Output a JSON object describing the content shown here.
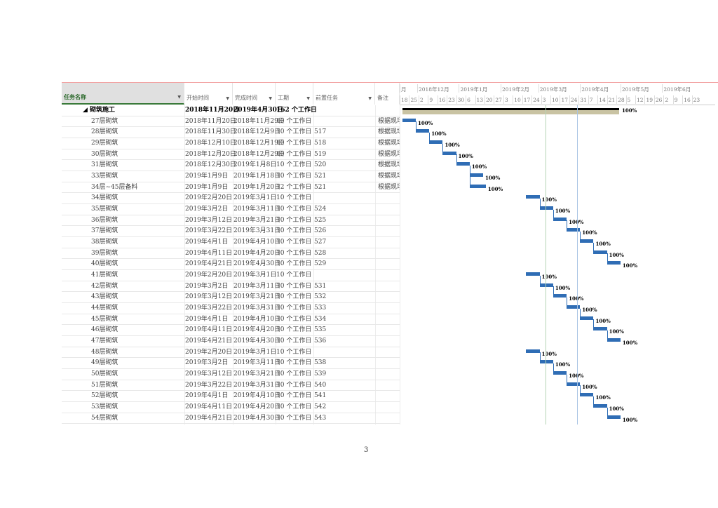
{
  "columns": {
    "name": "任务名称",
    "start": "开始时间",
    "finish": "完成时间",
    "duration": "工期",
    "predecessors": "前置任务",
    "notes": "备注"
  },
  "timescale": {
    "months": [
      "月",
      "2018年12月",
      "2019年1月",
      "2019年2月",
      "2019年3月",
      "2019年4月",
      "2019年5月",
      "2019年6月"
    ],
    "weeks": [
      "18",
      "25",
      "2",
      "9",
      "16",
      "23",
      "30",
      "6",
      "13",
      "20",
      "27",
      "3",
      "10",
      "17",
      "24",
      "3",
      "10",
      "17",
      "24",
      "31",
      "7",
      "14",
      "21",
      "28",
      "5",
      "12",
      "19",
      "26",
      "2",
      "9",
      "16",
      "23"
    ]
  },
  "summary": {
    "name": "砌筑施工",
    "start": "2018年11月20日",
    "finish": "2019年4月30日",
    "duration": "162 个工作日",
    "start_iso": "2018-11-20",
    "finish_iso": "2019-04-30",
    "progress": "100%"
  },
  "tasks": [
    {
      "name": "27层砌筑",
      "start": "2018年11月20日",
      "finish": "2018年11月29日",
      "duration": "10 个工作日",
      "pred": "",
      "note": "根据现场",
      "s": "2018-11-20",
      "f": "2018-11-29",
      "progress": "100%"
    },
    {
      "name": "28层砌筑",
      "start": "2018年11月30日",
      "finish": "2018年12月9日",
      "duration": "10 个工作日",
      "pred": "517",
      "note": "根据现场",
      "s": "2018-11-30",
      "f": "2018-12-09",
      "progress": "100%"
    },
    {
      "name": "29层砌筑",
      "start": "2018年12月10日",
      "finish": "2018年12月19日",
      "duration": "10 个工作日",
      "pred": "518",
      "note": "根据现场",
      "s": "2018-12-10",
      "f": "2018-12-19",
      "progress": "100%"
    },
    {
      "name": "30层砌筑",
      "start": "2018年12月20日",
      "finish": "2018年12月29日",
      "duration": "10 个工作日",
      "pred": "519",
      "note": "根据现场",
      "s": "2018-12-20",
      "f": "2018-12-29",
      "progress": "100%"
    },
    {
      "name": "31层砌筑",
      "start": "2018年12月30日",
      "finish": "2019年1月8日",
      "duration": "10 个工作日",
      "pred": "520",
      "note": "根据现场",
      "s": "2018-12-30",
      "f": "2019-01-08",
      "progress": "100%"
    },
    {
      "name": "33层砌筑",
      "start": "2019年1月9日",
      "finish": "2019年1月18日",
      "duration": "10 个工作日",
      "pred": "521",
      "note": "根据现场",
      "s": "2019-01-09",
      "f": "2019-01-18",
      "progress": "100%"
    },
    {
      "name": "34层~45层备料",
      "start": "2019年1月9日",
      "finish": "2019年1月20日",
      "duration": "12 个工作日",
      "pred": "521",
      "note": "根据现场",
      "s": "2019-01-09",
      "f": "2019-01-20",
      "progress": "100%"
    },
    {
      "name": "34层砌筑",
      "start": "2019年2月20日",
      "finish": "2019年3月1日",
      "duration": "10 个工作日",
      "pred": "",
      "note": "",
      "s": "2019-02-20",
      "f": "2019-03-01",
      "progress": "100%"
    },
    {
      "name": "35层砌筑",
      "start": "2019年3月2日",
      "finish": "2019年3月11日",
      "duration": "10 个工作日",
      "pred": "524",
      "note": "",
      "s": "2019-03-02",
      "f": "2019-03-11",
      "progress": "100%"
    },
    {
      "name": "36层砌筑",
      "start": "2019年3月12日",
      "finish": "2019年3月21日",
      "duration": "10 个工作日",
      "pred": "525",
      "note": "",
      "s": "2019-03-12",
      "f": "2019-03-21",
      "progress": "100%"
    },
    {
      "name": "37层砌筑",
      "start": "2019年3月22日",
      "finish": "2019年3月31日",
      "duration": "10 个工作日",
      "pred": "526",
      "note": "",
      "s": "2019-03-22",
      "f": "2019-03-31",
      "progress": "100%"
    },
    {
      "name": "38层砌筑",
      "start": "2019年4月1日",
      "finish": "2019年4月10日",
      "duration": "10 个工作日",
      "pred": "527",
      "note": "",
      "s": "2019-04-01",
      "f": "2019-04-10",
      "progress": "100%"
    },
    {
      "name": "39层砌筑",
      "start": "2019年4月11日",
      "finish": "2019年4月20日",
      "duration": "10 个工作日",
      "pred": "528",
      "note": "",
      "s": "2019-04-11",
      "f": "2019-04-20",
      "progress": "100%"
    },
    {
      "name": "40层砌筑",
      "start": "2019年4月21日",
      "finish": "2019年4月30日",
      "duration": "10 个工作日",
      "pred": "529",
      "note": "",
      "s": "2019-04-21",
      "f": "2019-04-30",
      "progress": "100%"
    },
    {
      "name": "41层砌筑",
      "start": "2019年2月20日",
      "finish": "2019年3月1日",
      "duration": "10 个工作日",
      "pred": "",
      "note": "",
      "s": "2019-02-20",
      "f": "2019-03-01",
      "progress": "100%"
    },
    {
      "name": "42层砌筑",
      "start": "2019年3月2日",
      "finish": "2019年3月11日",
      "duration": "10 个工作日",
      "pred": "531",
      "note": "",
      "s": "2019-03-02",
      "f": "2019-03-11",
      "progress": "100%"
    },
    {
      "name": "43层砌筑",
      "start": "2019年3月12日",
      "finish": "2019年3月21日",
      "duration": "10 个工作日",
      "pred": "532",
      "note": "",
      "s": "2019-03-12",
      "f": "2019-03-21",
      "progress": "100%"
    },
    {
      "name": "44层砌筑",
      "start": "2019年3月22日",
      "finish": "2019年3月31日",
      "duration": "10 个工作日",
      "pred": "533",
      "note": "",
      "s": "2019-03-22",
      "f": "2019-03-31",
      "progress": "100%"
    },
    {
      "name": "45层砌筑",
      "start": "2019年4月1日",
      "finish": "2019年4月10日",
      "duration": "10 个工作日",
      "pred": "534",
      "note": "",
      "s": "2019-04-01",
      "f": "2019-04-10",
      "progress": "100%"
    },
    {
      "name": "46层砌筑",
      "start": "2019年4月11日",
      "finish": "2019年4月20日",
      "duration": "10 个工作日",
      "pred": "535",
      "note": "",
      "s": "2019-04-11",
      "f": "2019-04-20",
      "progress": "100%"
    },
    {
      "name": "47层砌筑",
      "start": "2019年4月21日",
      "finish": "2019年4月30日",
      "duration": "10 个工作日",
      "pred": "536",
      "note": "",
      "s": "2019-04-21",
      "f": "2019-04-30",
      "progress": "100%"
    },
    {
      "name": "48层砌筑",
      "start": "2019年2月20日",
      "finish": "2019年3月1日",
      "duration": "10 个工作日",
      "pred": "",
      "note": "",
      "s": "2019-02-20",
      "f": "2019-03-01",
      "progress": "100%"
    },
    {
      "name": "49层砌筑",
      "start": "2019年3月2日",
      "finish": "2019年3月11日",
      "duration": "10 个工作日",
      "pred": "538",
      "note": "",
      "s": "2019-03-02",
      "f": "2019-03-11",
      "progress": "100%"
    },
    {
      "name": "50层砌筑",
      "start": "2019年3月12日",
      "finish": "2019年3月21日",
      "duration": "10 个工作日",
      "pred": "539",
      "note": "",
      "s": "2019-03-12",
      "f": "2019-03-21",
      "progress": "100%"
    },
    {
      "name": "51层砌筑",
      "start": "2019年3月22日",
      "finish": "2019年3月31日",
      "duration": "10 个工作日",
      "pred": "540",
      "note": "",
      "s": "2019-03-22",
      "f": "2019-03-31",
      "progress": "100%"
    },
    {
      "name": "52层砌筑",
      "start": "2019年4月1日",
      "finish": "2019年4月10日",
      "duration": "10 个工作日",
      "pred": "541",
      "note": "",
      "s": "2019-04-01",
      "f": "2019-04-10",
      "progress": "100%"
    },
    {
      "name": "53层砌筑",
      "start": "2019年4月11日",
      "finish": "2019年4月20日",
      "duration": "10 个工作日",
      "pred": "542",
      "note": "",
      "s": "2019-04-11",
      "f": "2019-04-20",
      "progress": "100%"
    },
    {
      "name": "54层砌筑",
      "start": "2019年4月21日",
      "finish": "2019年4月30日",
      "duration": "10 个工作日",
      "pred": "543",
      "note": "",
      "s": "2019-04-21",
      "f": "2019-04-30",
      "progress": "100%"
    }
  ],
  "page_number": "3"
}
